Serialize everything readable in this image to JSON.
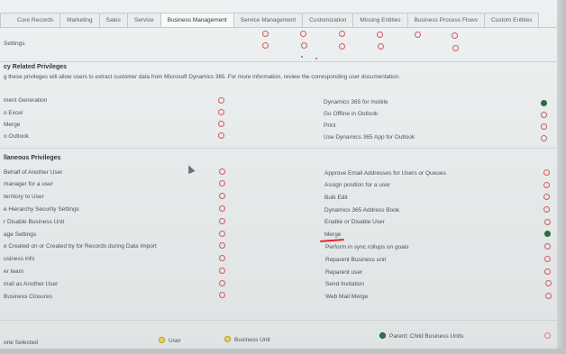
{
  "tabs": [
    {
      "label": "Core Records"
    },
    {
      "label": "Marketing"
    },
    {
      "label": "Sales"
    },
    {
      "label": "Service"
    },
    {
      "label": "Business Management"
    },
    {
      "label": "Service Management"
    },
    {
      "label": "Customization"
    },
    {
      "label": "Missing Entities"
    },
    {
      "label": "Business Process Flows"
    },
    {
      "label": "Custom Entities"
    }
  ],
  "top_row": {
    "label": "Settings"
  },
  "privacy": {
    "title": "cy Related Privileges",
    "description": "g these privileges will allow users to extract customer data from Microsoft Dynamics 365. For more information, review the corresponding user documentation.",
    "left": [
      "ment Generation",
      "o Excel",
      "Merge",
      "o Outlook"
    ],
    "right": [
      "Dynamics 365 for mobile",
      "Go Offline in Outlook",
      "Print",
      "Use Dynamics 365 App for Outlook"
    ]
  },
  "misc": {
    "title": "llaneous Privileges",
    "left": [
      "Behalf of Another User",
      "manager for a user",
      "territory to User",
      "e Hierarchy Security Settings",
      "r Disable Business Unit",
      "age Settings",
      "e Created on or Created by for Records during Data Import",
      "usiness info",
      "er team",
      "mail as Another User",
      "Business Closures"
    ],
    "right": [
      "Approve Email Addresses for Users or Queues",
      "Assign position for a user",
      "Bulk Edit",
      "Dynamics 365 Address Book",
      "Enable or Disable User",
      "Merge",
      "Perform in sync rollups on goals",
      "Reparent Business unit",
      "Reparent user",
      "Send Invitation",
      "Web Mail Merge"
    ]
  },
  "legend": {
    "none": "one Selected",
    "user": "User",
    "business_unit": "Business Unit",
    "parent_child": "Parent: Child Business Units"
  },
  "colors": {
    "empty_ring": "#d35a5f",
    "selected": "#2f6a3f",
    "highlight": "#e0262b"
  }
}
